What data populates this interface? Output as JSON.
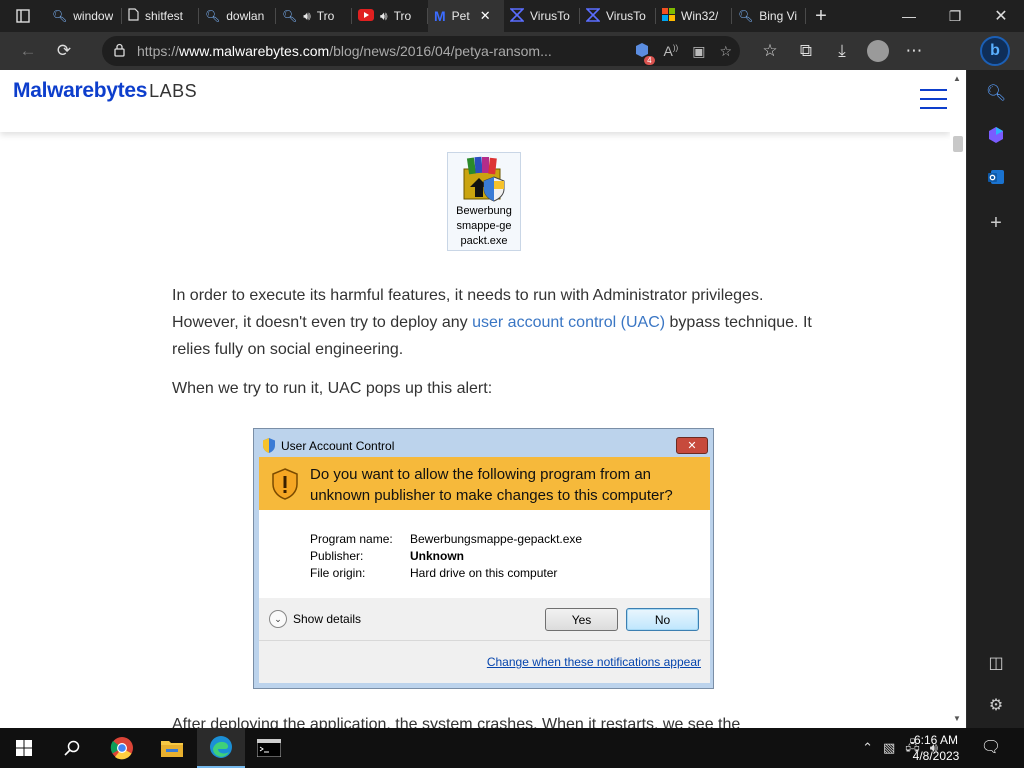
{
  "browser": {
    "tabs": [
      {
        "label": "window",
        "icon": "search-icon"
      },
      {
        "label": "shitfest",
        "icon": "page-icon"
      },
      {
        "label": "dowlan",
        "icon": "search-icon"
      },
      {
        "label": "Tro",
        "icon": "search-icon"
      },
      {
        "label": "Tro",
        "icon": "youtube-icon"
      },
      {
        "label": "Pet",
        "icon": "malwarebytes-icon"
      },
      {
        "label": "VirusTo",
        "icon": "virustotal-icon"
      },
      {
        "label": "VirusTo",
        "icon": "virustotal-icon"
      },
      {
        "label": "Win32/",
        "icon": "windows-icon"
      },
      {
        "label": "Bing Vi",
        "icon": "search-icon"
      }
    ],
    "address": {
      "scheme": "https://",
      "host": "www.malwarebytes.com",
      "path": "/blog/news/2016/04/petya-ransom..."
    },
    "extension_badge": "4"
  },
  "site": {
    "logo_main": "Malwarebytes",
    "logo_labs": "LABS"
  },
  "article": {
    "file_icon_caption": "Bewerbung smappe-ge packt.exe",
    "para1_pre": "In order to execute its harmful features, it needs to run with Administrator privileges. However, it doesn't even try to deploy any ",
    "para1_link": "user account control (UAC)",
    "para1_post": " bypass technique. It relies fully on social engineering.",
    "para2": "When we try to run it, UAC pops up this alert:",
    "para3_cut": "After deploying the application, the system crashes. When it restarts, we see the"
  },
  "uac": {
    "title": "User Account Control",
    "question": "Do you want to allow the following program from an unknown publisher to make changes to this computer?",
    "rows": [
      {
        "key": "Program name:",
        "value": "Bewerbungsmappe-gepackt.exe"
      },
      {
        "key": "Publisher:",
        "value": "Unknown"
      },
      {
        "key": "File origin:",
        "value": "Hard drive on this computer"
      }
    ],
    "show_details": "Show details",
    "yes": "Yes",
    "no": "No",
    "link": "Change when these notifications appear",
    "close": "✕"
  },
  "taskbar": {
    "time": "6:16 AM",
    "date": "4/8/2023"
  },
  "colors": {
    "brand": "#0d3ecc",
    "uac_banner": "#f6b93b",
    "link": "#3a76c4"
  }
}
